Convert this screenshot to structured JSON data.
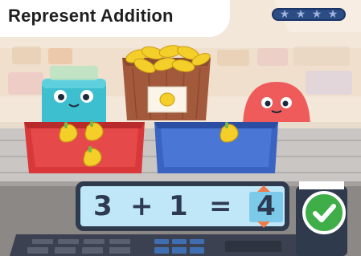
{
  "header": {
    "title": "Represent Addition",
    "stars": [
      "star-icon",
      "star-icon",
      "star-icon",
      "star-icon"
    ]
  },
  "equation": {
    "addend_a": "3",
    "plus": "+",
    "addend_b": "1",
    "equals": "=",
    "answer": "4"
  },
  "bins": {
    "left_count": 3,
    "right_count": 1
  },
  "colors": {
    "background_wall": "#f2e6d8",
    "left_bin": "#d8383a",
    "right_bin": "#3a63c2",
    "check_button": "#3fae49",
    "equation_panel": "#bfe7f7",
    "arrow": "#f07a4a"
  }
}
